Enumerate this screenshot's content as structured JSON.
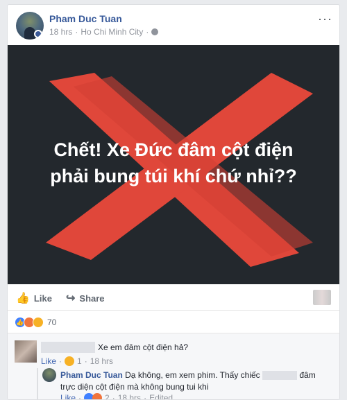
{
  "post": {
    "author": "Pham Duc Tuan",
    "time": "18 hrs",
    "separator": "·",
    "location": "Ho Chi Minh City",
    "more_icon": "more-options-icon",
    "image": {
      "caption_line1": "Chết! Xe Đức đâm cột điện",
      "caption_line2": "phải bung túi khí chứ nhỉ??",
      "background": "#23282d",
      "x_color": "#e0473a"
    }
  },
  "actions": {
    "like": "Like",
    "share": "Share"
  },
  "reactions": {
    "count": "70",
    "types": [
      "like-icon",
      "angry-icon",
      "haha-icon"
    ]
  },
  "comments": [
    {
      "text": "Xe em đâm cột điện hả?",
      "like": "Like",
      "sep": "·",
      "reaction_count": "1",
      "time": "18 hrs"
    }
  ],
  "reply": {
    "author": "Pham Duc Tuan",
    "text_a": "Dạ không, em xem phim. Thấy chiếc",
    "text_b": "đâm trực diện cột điện mà không bung tui khi",
    "like": "Like",
    "sep": "·",
    "reaction_count": "2",
    "time": "18 hrs",
    "edited": "Edited"
  }
}
